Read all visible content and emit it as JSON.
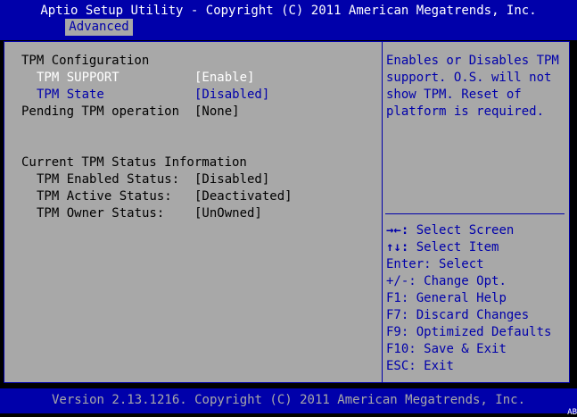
{
  "header": {
    "title": "Aptio Setup Utility - Copyright (C) 2011 American Megatrends, Inc.",
    "active_tab": "Advanced"
  },
  "main": {
    "section_title": "TPM Configuration",
    "settings": [
      {
        "label": "TPM SUPPORT",
        "value": "[Enable]"
      },
      {
        "label": "TPM State",
        "value": "[Disabled]"
      },
      {
        "label": "Pending TPM operation",
        "value": "[None]"
      }
    ],
    "status_title": "Current TPM Status Information",
    "status": [
      {
        "label": "TPM Enabled Status:",
        "value": "[Disabled]"
      },
      {
        "label": "TPM Active Status:",
        "value": "[Deactivated]"
      },
      {
        "label": "TPM Owner Status:",
        "value": "[UnOwned]"
      }
    ]
  },
  "help": {
    "text": "Enables or Disables TPM support. O.S. will not show TPM. Reset of platform is required."
  },
  "keys": [
    {
      "key": "→←:",
      "action": "Select Screen"
    },
    {
      "key": "↑↓:",
      "action": "Select Item"
    },
    {
      "key": "Enter:",
      "action": "Select"
    },
    {
      "key": "+/-:",
      "action": "Change Opt."
    },
    {
      "key": "F1:",
      "action": "General Help"
    },
    {
      "key": "F7:",
      "action": "Discard Changes"
    },
    {
      "key": "F9:",
      "action": "Optimized Defaults"
    },
    {
      "key": "F10:",
      "action": "Save & Exit"
    },
    {
      "key": "ESC:",
      "action": "Exit"
    }
  ],
  "footer": {
    "version": "Version 2.13.1216. Copyright (C) 2011 American Megatrends, Inc.",
    "corner_code": "AB"
  },
  "colors": {
    "bios_blue": "#0000aa",
    "panel_gray": "#a8a8a8",
    "highlight_white": "#ffffff"
  }
}
